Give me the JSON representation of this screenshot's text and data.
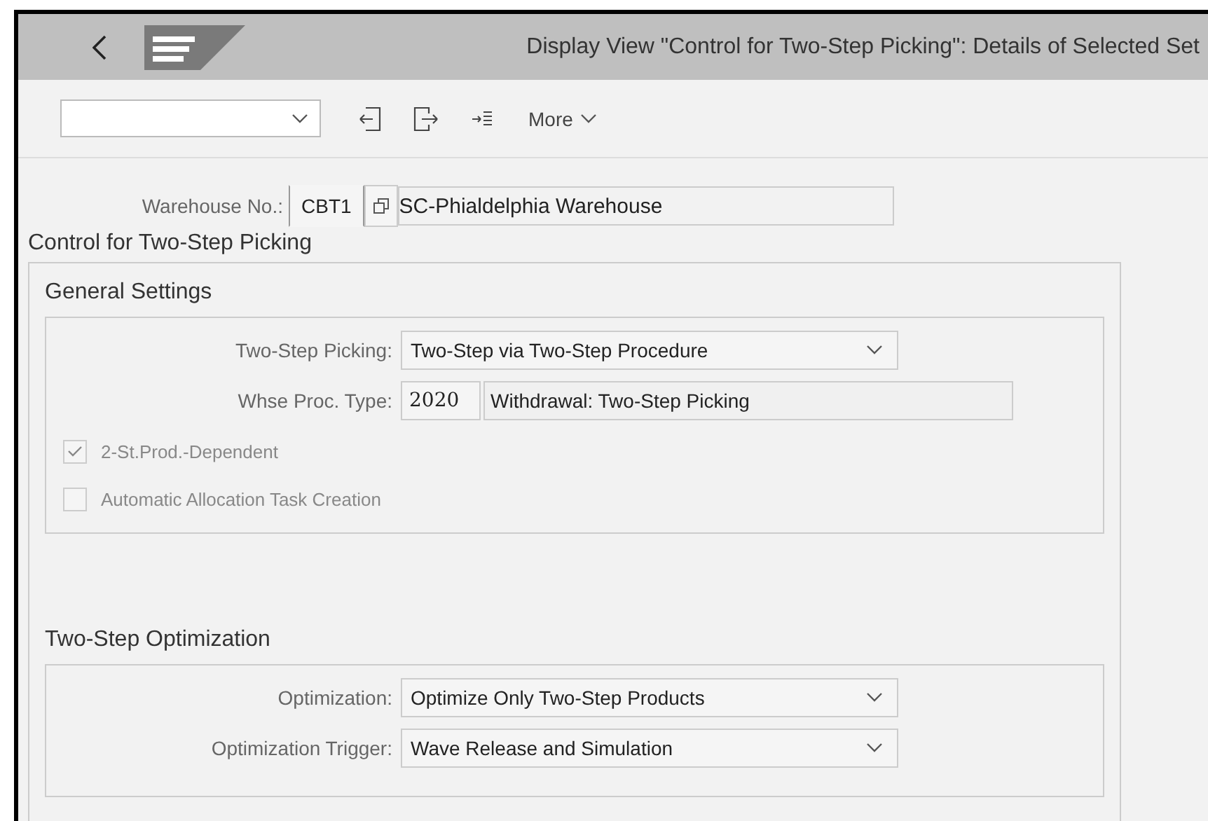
{
  "header": {
    "title": "Display View \"Control for Two-Step Picking\": Details of Selected Set"
  },
  "toolbar": {
    "more": "More"
  },
  "warehouse": {
    "label": "Warehouse No.:",
    "code": "CBT1",
    "name": "SC-Phialdelphia Warehouse"
  },
  "section_title": "Control for Two-Step Picking",
  "groups": [
    {
      "title": "General Settings",
      "fields": [
        {
          "kind": "dropdown",
          "label": "Two-Step Picking:",
          "value": "Two-Step via Two-Step Procedure"
        },
        {
          "kind": "code_pair",
          "label": "Whse Proc. Type:",
          "code": "2020",
          "text": "Withdrawal: Two-Step Picking"
        }
      ],
      "checkboxes": [
        {
          "label": "2-St.Prod.-Dependent",
          "checked": true,
          "disabled": true
        },
        {
          "label": "Automatic Allocation Task Creation",
          "checked": false,
          "disabled": true
        }
      ]
    },
    {
      "title": "Two-Step Optimization",
      "fields": [
        {
          "kind": "dropdown",
          "label": "Optimization:",
          "value": "Optimize Only Two-Step Products"
        },
        {
          "kind": "dropdown",
          "label": "Optimization Trigger:",
          "value": "Wave Release and Simulation"
        }
      ]
    }
  ]
}
